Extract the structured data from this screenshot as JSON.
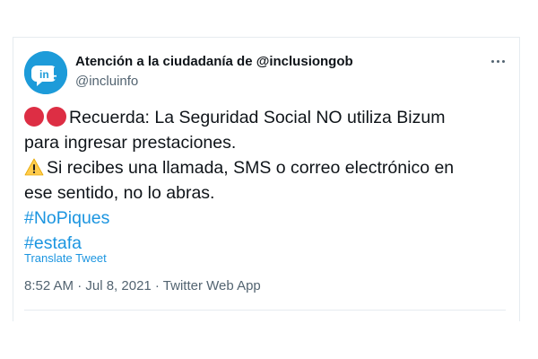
{
  "tweet": {
    "display_name": "Atención a la ciudadanía de @inclusiongob",
    "handle": "@incluinfo",
    "avatar_text": "in",
    "lines": [
      "Recuerda: La Seguridad Social NO utiliza Bizum",
      "para ingresar prestaciones.",
      "Si recibes una llamada, SMS o correo electrónico en",
      "ese sentido, no lo abras."
    ],
    "hashtags": [
      "#NoPiques",
      "#estafa"
    ],
    "translate_label": "Translate Tweet",
    "timestamp": "8:52 AM · Jul 8, 2021 · Twitter Web App"
  },
  "icons": {
    "avatar": "inclusion-logo-icon",
    "more": "more-horizontal-icon",
    "emoji1": "red-circle-icon",
    "emoji2": "warning-icon"
  },
  "colors": {
    "link": "#1b95e0",
    "avatar_bg": "#1d9bd9",
    "red_circle": "#dd2e44",
    "warning": "#ffcc4d"
  }
}
